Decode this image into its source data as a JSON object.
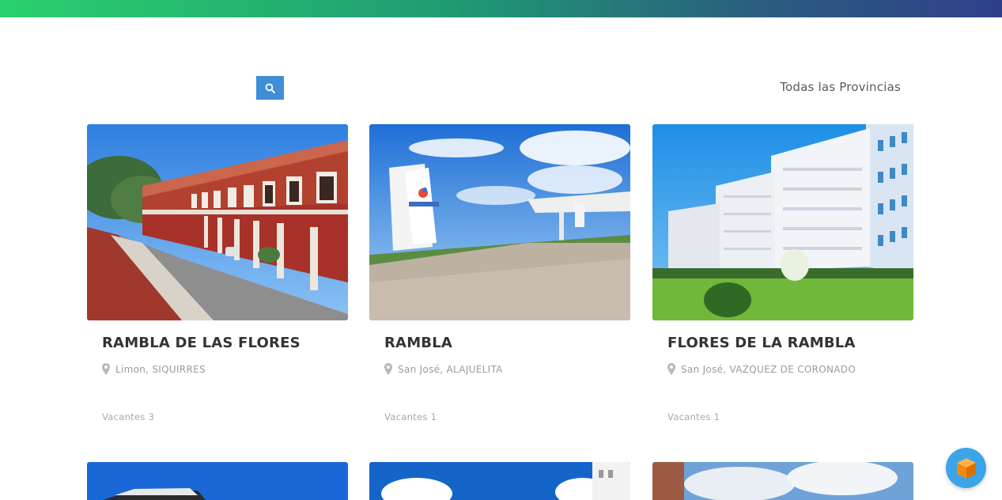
{
  "toolbar": {
    "search_icon": "search-icon",
    "province_filter": "Todas las Provincias"
  },
  "cards": [
    {
      "title": "RAMBLA DE LAS FLORES",
      "location": "Limon, SIQUIRRES",
      "vacancies_label": "Vacantes",
      "vacancies": "3"
    },
    {
      "title": "RAMBLA",
      "location": "San José, ALAJUELITA",
      "vacancies_label": "Vacantes",
      "vacancies": "1"
    },
    {
      "title": "FLORES DE LA RAMBLA",
      "location": "San José, VAZQUEZ DE CORONADO",
      "vacancies_label": "Vacantes",
      "vacancies": "1"
    }
  ],
  "colors": {
    "accent": "#3f8ed8",
    "help_button": "#3ba5e8"
  }
}
